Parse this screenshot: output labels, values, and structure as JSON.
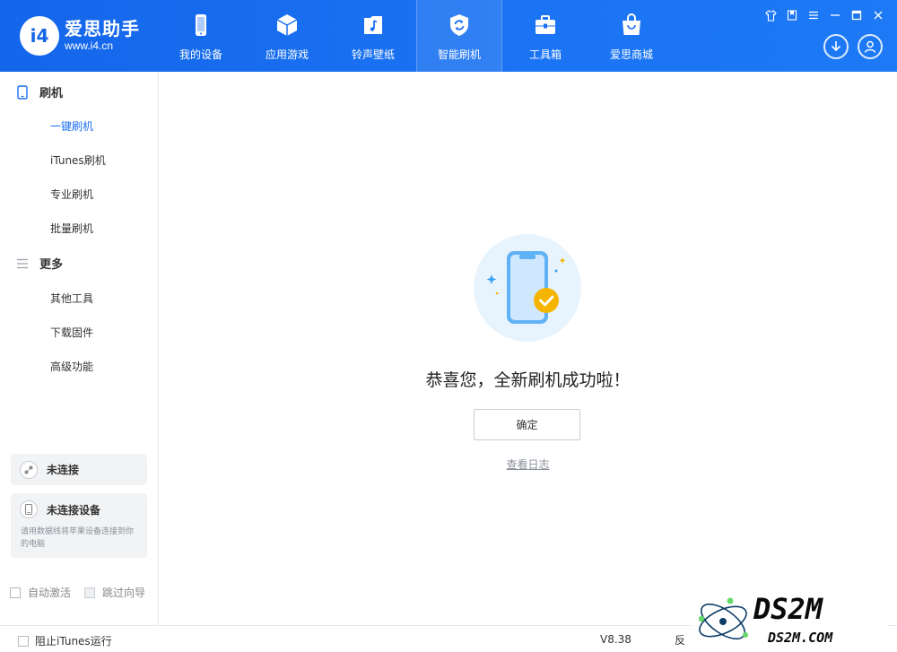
{
  "app": {
    "logo_mark": "i4",
    "name": "爱思助手",
    "url": "www.i4.cn"
  },
  "nav": [
    {
      "label": "我的设备",
      "icon": "phone-icon"
    },
    {
      "label": "应用游戏",
      "icon": "cube-icon"
    },
    {
      "label": "铃声壁纸",
      "icon": "music-file-icon"
    },
    {
      "label": "智能刷机",
      "icon": "refresh-shield-icon",
      "active": true
    },
    {
      "label": "工具箱",
      "icon": "toolbox-icon"
    },
    {
      "label": "爱思商城",
      "icon": "shopping-bag-icon"
    }
  ],
  "window_controls": [
    "shirt-icon",
    "bookmark-icon",
    "list-icon",
    "minimize-icon",
    "maximize-icon",
    "close-icon"
  ],
  "header_actions": [
    "download-icon",
    "user-icon"
  ],
  "sidebar": {
    "section1": {
      "label": "刷机",
      "icon": "phone-outline-icon"
    },
    "section1_items": [
      "一键刷机",
      "iTunes刷机",
      "专业刷机",
      "批量刷机"
    ],
    "active_item": "一键刷机",
    "section2": {
      "label": "更多",
      "icon": "menu-icon"
    },
    "section2_items": [
      "其他工具",
      "下载固件",
      "高级功能"
    ],
    "connection": {
      "title": "未连接"
    },
    "device": {
      "title": "未连接设备",
      "desc": "请用数据线将苹果设备连接到你的电脑"
    },
    "auto_activate": "自动激活",
    "skip_guide": "跳过向导"
  },
  "main": {
    "message": "恭喜您，全新刷机成功啦！",
    "confirm": "确定",
    "view_log": "查看日志"
  },
  "footer": {
    "block_itunes": "阻止iTunes运行",
    "version": "V8.38",
    "truncated": "反"
  },
  "watermark": {
    "brand": "DS2M",
    "domain": "DS2M.COM"
  },
  "colors": {
    "primary": "#1b6ef3",
    "header": "#1466ea",
    "success": "#f5b400"
  }
}
